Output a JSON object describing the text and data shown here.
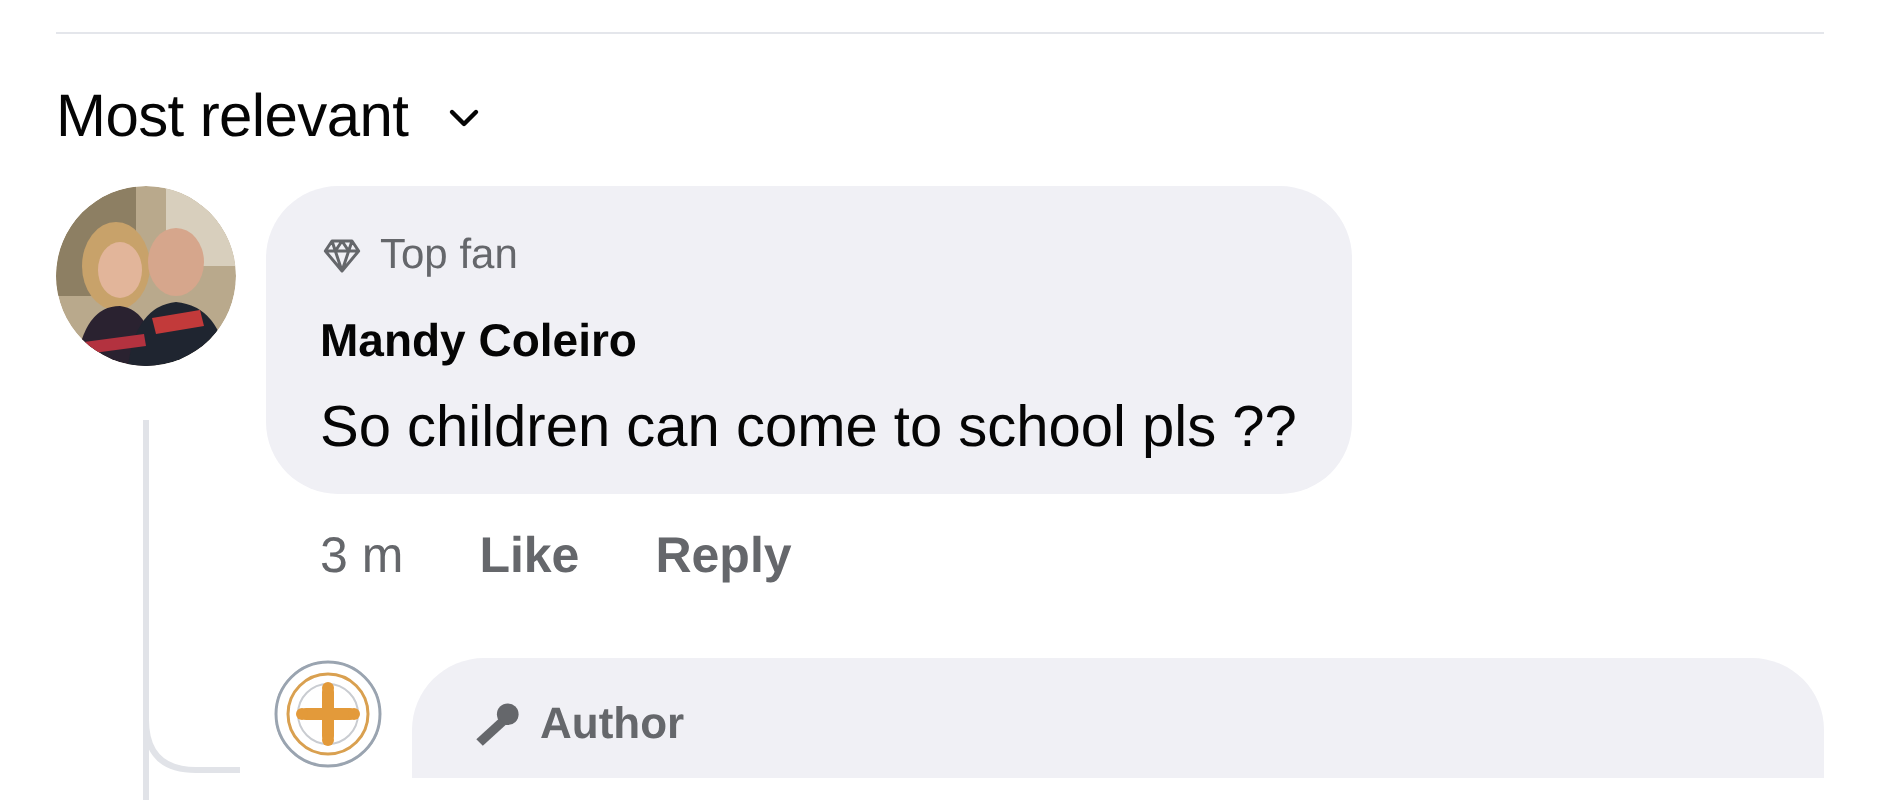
{
  "sort": {
    "label": "Most relevant"
  },
  "comments": [
    {
      "avatar": {
        "kind": "picture"
      },
      "badge": {
        "kind": "fan",
        "label": "Top fan"
      },
      "author": "Mandy Coleiro",
      "text": "So children can come to school pls ??",
      "time": "3 m",
      "actions": [
        "Like",
        "Reply"
      ],
      "replies": [
        {
          "avatar": {
            "kind": "emblem"
          },
          "badge": {
            "kind": "author",
            "label": "Author"
          }
        }
      ]
    }
  ]
}
